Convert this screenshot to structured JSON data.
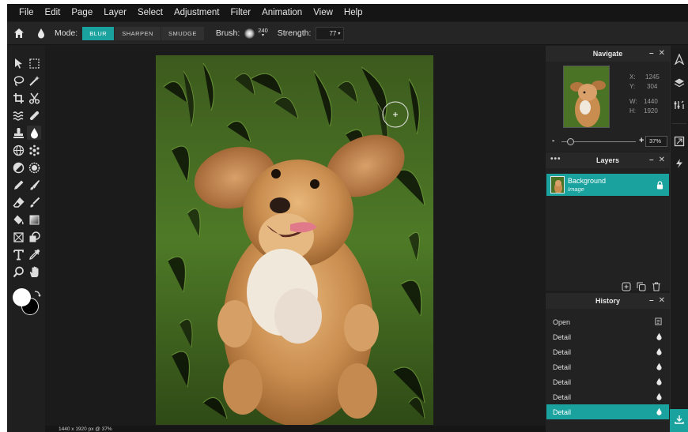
{
  "menu": [
    "File",
    "Edit",
    "Page",
    "Layer",
    "Select",
    "Adjustment",
    "Filter",
    "Animation",
    "View",
    "Help"
  ],
  "options": {
    "mode_label": "Mode:",
    "modes": [
      "BLUR",
      "SHARPEN",
      "SMUDGE"
    ],
    "active_mode": "BLUR",
    "brush_label": "Brush:",
    "brush_size": "240",
    "strength_label": "Strength:",
    "strength_value": "77"
  },
  "navigate": {
    "title": "Navigate",
    "x_label": "X:",
    "x_value": "1245",
    "y_label": "Y:",
    "y_value": "304",
    "w_label": "W:",
    "w_value": "1440",
    "h_label": "H:",
    "h_value": "1920",
    "zoom_minus": "-",
    "zoom_plus": "+",
    "zoom_value": "37%",
    "zoom_fraction": 0.12
  },
  "layers": {
    "title": "Layers",
    "items": [
      {
        "name": "Background",
        "type": "Image"
      }
    ]
  },
  "history": {
    "title": "History",
    "items": [
      "Open",
      "Detail",
      "Detail",
      "Detail",
      "Detail",
      "Detail",
      "Detail"
    ],
    "active_index": 6
  },
  "status": {
    "text": "1440 x 1920 px @ 37%"
  },
  "colors": {
    "accent": "#1aa39e",
    "primary_color": "#ffffff",
    "secondary_color": "#000000"
  },
  "icons": {
    "home": "home-icon",
    "tool_drop": "water-drop-icon",
    "download": "download-icon"
  }
}
